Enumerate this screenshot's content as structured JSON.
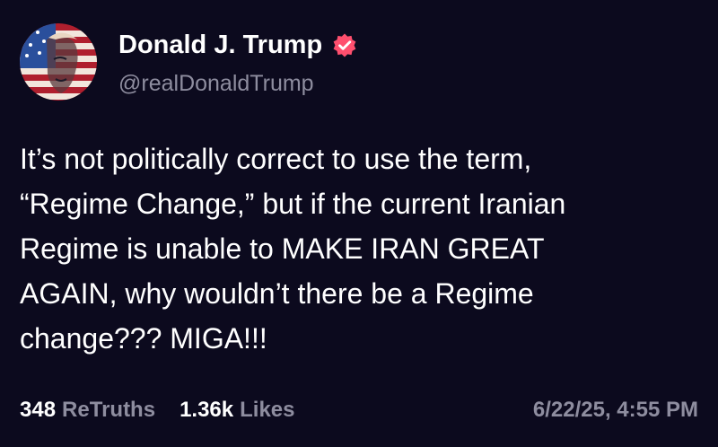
{
  "author": {
    "display_name": "Donald J. Trump",
    "handle": "@realDonaldTrump",
    "verified_icon": "verified-badge-icon",
    "badge_color": "#ff4f6e"
  },
  "post": {
    "text": "It’s not politically correct to use the term,\n“Regime Change,” but if the current Iranian\nRegime is unable to MAKE IRAN GREAT\nAGAIN, why wouldn’t there be a Regime\nchange??? MIGA!!!"
  },
  "stats": {
    "retruths_count": "348",
    "retruths_label": "ReTruths",
    "likes_count": "1.36k",
    "likes_label": "Likes"
  },
  "timestamp": "6/22/25, 4:55 PM",
  "colors": {
    "background": "#0c0a1e",
    "text": "#ffffff",
    "muted": "#8e8d9f"
  }
}
